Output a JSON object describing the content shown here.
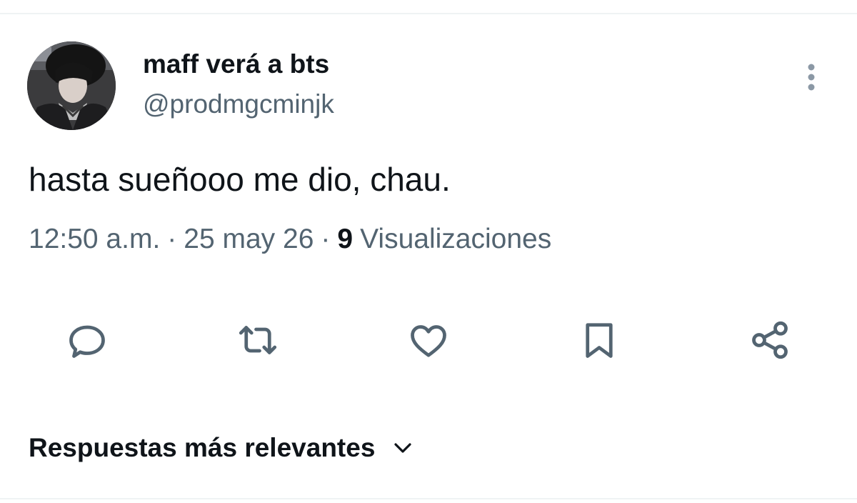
{
  "tweet": {
    "display_name": "maff verá a bts",
    "handle": "@prodmgcminjk",
    "text": "hasta sueñooo me dio, chau.",
    "time": "12:50 a.m.",
    "date": "25 may 26",
    "separator": "·",
    "views_count": "9",
    "views_label": "Visualizaciones"
  },
  "actions": [
    {
      "name": "reply",
      "icon": "reply-icon"
    },
    {
      "name": "retweet",
      "icon": "retweet-icon"
    },
    {
      "name": "like",
      "icon": "heart-icon"
    },
    {
      "name": "bookmark",
      "icon": "bookmark-icon"
    },
    {
      "name": "share",
      "icon": "share-icon"
    }
  ],
  "replies_sort": {
    "label": "Respuestas más relevantes",
    "icon": "chevron-down-icon"
  },
  "colors": {
    "primary_text": "#0f1419",
    "secondary_text": "#536471",
    "divider": "#eff3f4",
    "background": "#ffffff"
  }
}
